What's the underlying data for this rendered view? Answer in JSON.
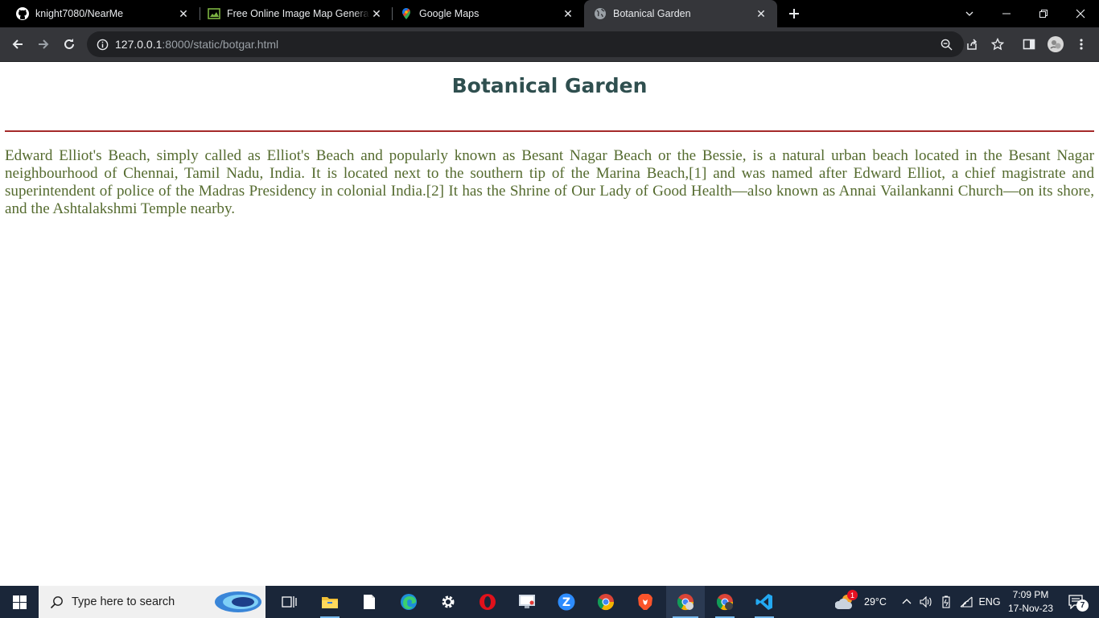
{
  "browser": {
    "tabs": [
      {
        "title": "knight7080/NearMe",
        "icon": "github-icon"
      },
      {
        "title": "Free Online Image Map Generator",
        "icon": "image-icon"
      },
      {
        "title": "Google Maps",
        "icon": "google-maps-icon"
      },
      {
        "title": "Botanical Garden",
        "icon": "globe-icon",
        "active": true
      }
    ],
    "url": {
      "host": "127.0.0.1",
      "path": ":8000/static/botgar.html"
    }
  },
  "page": {
    "title": "Botanical Garden",
    "paragraph": "Edward Elliot's Beach, simply called as Elliot's Beach and popularly known as Besant Nagar Beach or the Bessie, is a natural urban beach located in the Besant Nagar neighbourhood of Chennai, Tamil Nadu, India. It is located next to the southern tip of the Marina Beach,[1] and was named after Edward Elliot, a chief magistrate and superintendent of police of the Madras Presidency in colonial India.[2] It has the Shrine of Our Lady of Good Health—also known as Annai Vailankanni Church—on its shore, and the Ashtalakshmi Temple nearby."
  },
  "taskbar": {
    "search_placeholder": "Type here to search",
    "weather": {
      "temp": "29°C",
      "badge": "1"
    },
    "language": "ENG",
    "time": "7:09 PM",
    "date": "17-Nov-23",
    "notification_count": "7"
  },
  "colors": {
    "title": "#2f4f4f",
    "rule": "#a52a2a",
    "paragraph": "#556b2f"
  }
}
